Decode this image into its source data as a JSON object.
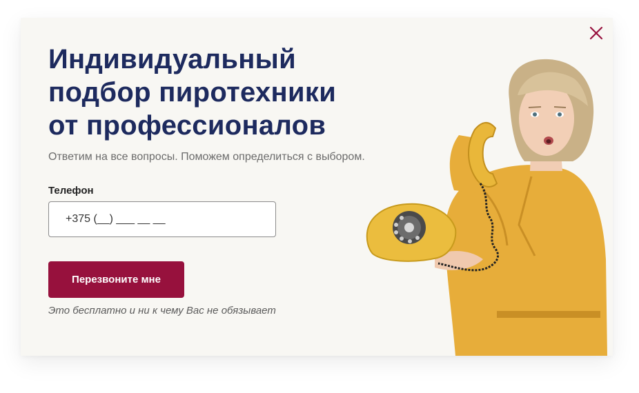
{
  "modal": {
    "title_lines": [
      "Индивидуальный",
      "подбор пиротехники",
      "от профессионалов"
    ],
    "subtitle": "Ответим на все вопросы. Поможем определиться с выбором.",
    "phone_label": "Телефон",
    "phone_placeholder": "+375 (__) ___ __ __",
    "submit_label": "Перезвоните мне",
    "note": "Это бесплатно и ни к чему Вас не обязывает"
  },
  "colors": {
    "title": "#1d2a5e",
    "accent": "#97113d",
    "background": "#f8f7f3"
  },
  "icons": {
    "close": "close-icon"
  }
}
